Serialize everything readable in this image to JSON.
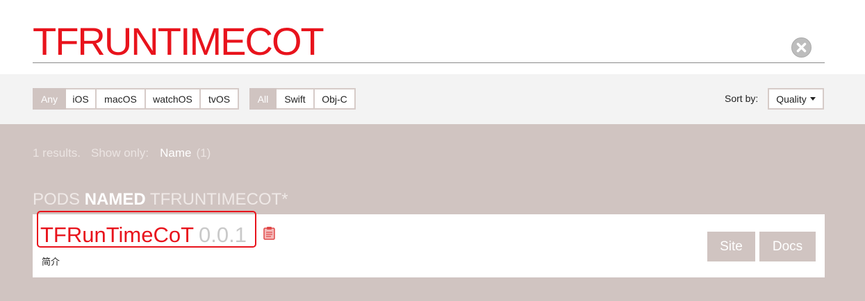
{
  "search": {
    "query": "TFRUNTIMECOT",
    "clear_icon": "close-circle-icon"
  },
  "filters": {
    "platforms": [
      {
        "label": "Any",
        "selected": true
      },
      {
        "label": "iOS",
        "selected": false
      },
      {
        "label": "macOS",
        "selected": false
      },
      {
        "label": "watchOS",
        "selected": false
      },
      {
        "label": "tvOS",
        "selected": false
      }
    ],
    "languages": [
      {
        "label": "All",
        "selected": true
      },
      {
        "label": "Swift",
        "selected": false
      },
      {
        "label": "Obj-C",
        "selected": false
      }
    ]
  },
  "sort": {
    "label": "Sort by:",
    "value": "Quality",
    "icon": "caret-down-icon"
  },
  "results": {
    "count_text": "1 results.",
    "show_only_label": "Show only:",
    "filters": [
      {
        "label": "Name",
        "count": "(1)"
      }
    ]
  },
  "section": {
    "prefix": "PODS",
    "emphasis": "NAMED",
    "query": "TFRUNTIMECOT*"
  },
  "pods": [
    {
      "name": "TFRunTimeCoT",
      "version": "0.0.1",
      "summary": "简介",
      "copy_icon": "clipboard-icon",
      "links": [
        "Site",
        "Docs"
      ]
    }
  ],
  "colors": {
    "accent": "#e8131c",
    "muted": "#d0c4c1",
    "filter_bar": "#f3f3f3",
    "version_text": "#c9c9c9",
    "annotation": "#e8131c"
  }
}
